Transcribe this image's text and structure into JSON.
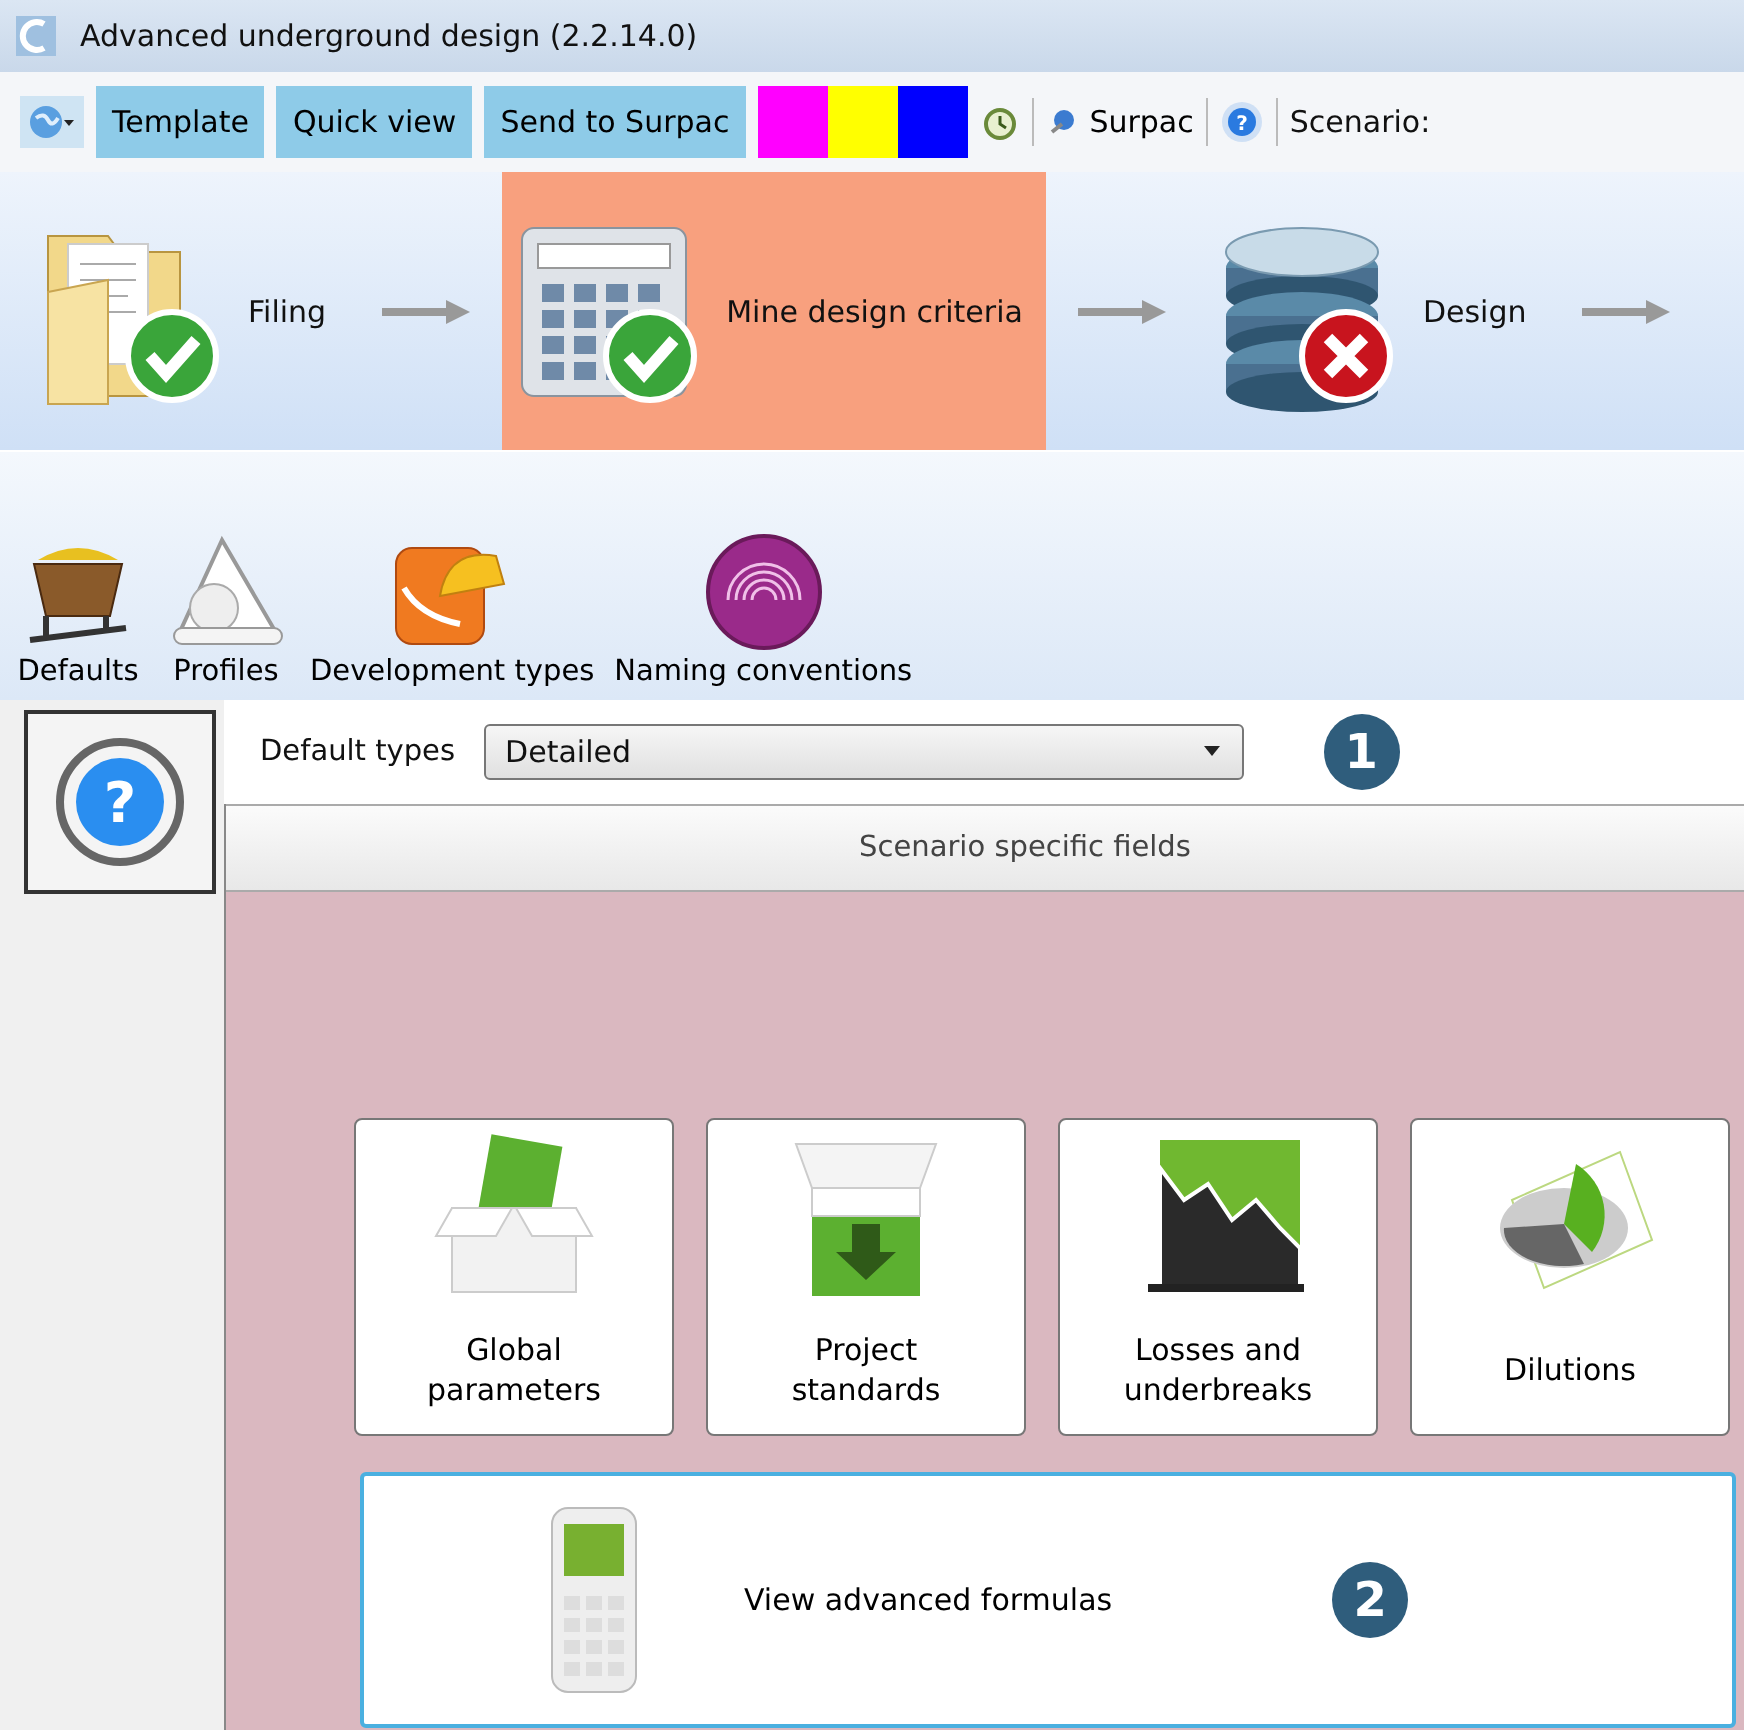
{
  "window": {
    "title": "Advanced underground design (2.2.14.0)"
  },
  "toolbar": {
    "buttons": [
      "Template",
      "Quick view",
      "Send to Surpac"
    ],
    "swatches": [
      {
        "color": "#ff00ff"
      },
      {
        "color": "#ffff00"
      },
      {
        "color": "#0000ff"
      }
    ],
    "surpac": "Surpac",
    "help": "?",
    "scenario": "Scenario:"
  },
  "side": {
    "help": "?"
  },
  "workflow": [
    {
      "label": "Filing",
      "kind": "folder",
      "completed": true,
      "selected": false
    },
    {
      "label": "Mine design criteria",
      "kind": "calculator",
      "completed": true,
      "selected": true
    },
    {
      "label": "Design",
      "kind": "database",
      "completed": false,
      "selected": false
    }
  ],
  "ribbon": [
    {
      "label": "Defaults",
      "kind": "cart"
    },
    {
      "label": "Profiles",
      "kind": "profile"
    },
    {
      "label": "Development types",
      "kind": "helmet"
    },
    {
      "label": "Naming conventions",
      "kind": "fingerprint"
    }
  ],
  "form": {
    "label": "Default types",
    "value": "Detailed",
    "marker": "1"
  },
  "panel": {
    "header": "Scenario specific fields",
    "tiles": [
      {
        "label": "Global parameters",
        "kind": "box"
      },
      {
        "label": "Project standards",
        "kind": "download"
      },
      {
        "label": "Losses and underbreaks",
        "kind": "chart"
      },
      {
        "label": "Dilutions",
        "kind": "pie"
      }
    ],
    "wide": {
      "label": "View advanced formulas",
      "marker": "2"
    }
  }
}
